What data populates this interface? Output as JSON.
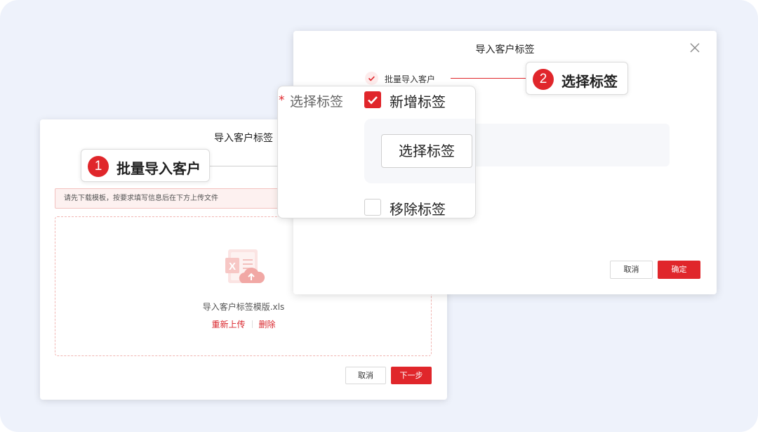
{
  "colors": {
    "accent": "#e0262b",
    "background": "#eef2fb"
  },
  "import_dialog": {
    "title": "导入客户标签",
    "notice": "请先下载模板，按要求填写信息后在下方上传文件",
    "file_name": "导入客户标签模版.xls",
    "file_icon": "excel-upload-icon",
    "reupload_label": "重新上传",
    "delete_label": "删除",
    "cancel_label": "取消",
    "next_label": "下一步"
  },
  "tag_dialog": {
    "title": "导入客户标签",
    "close_icon": "close-icon",
    "step1_label": "批量导入客户",
    "cancel_label": "取消",
    "confirm_label": "确定"
  },
  "callouts": [
    {
      "number": "1",
      "label": "批量导入客户"
    },
    {
      "number": "2",
      "label": "选择标签"
    }
  ],
  "tag_panel": {
    "required_mark": "*",
    "field_label": "选择标签",
    "add_tag_label": "新增标签",
    "add_tag_checked": true,
    "select_button_label": "选择标签",
    "remove_tag_label": "移除标签",
    "remove_tag_checked": false
  }
}
